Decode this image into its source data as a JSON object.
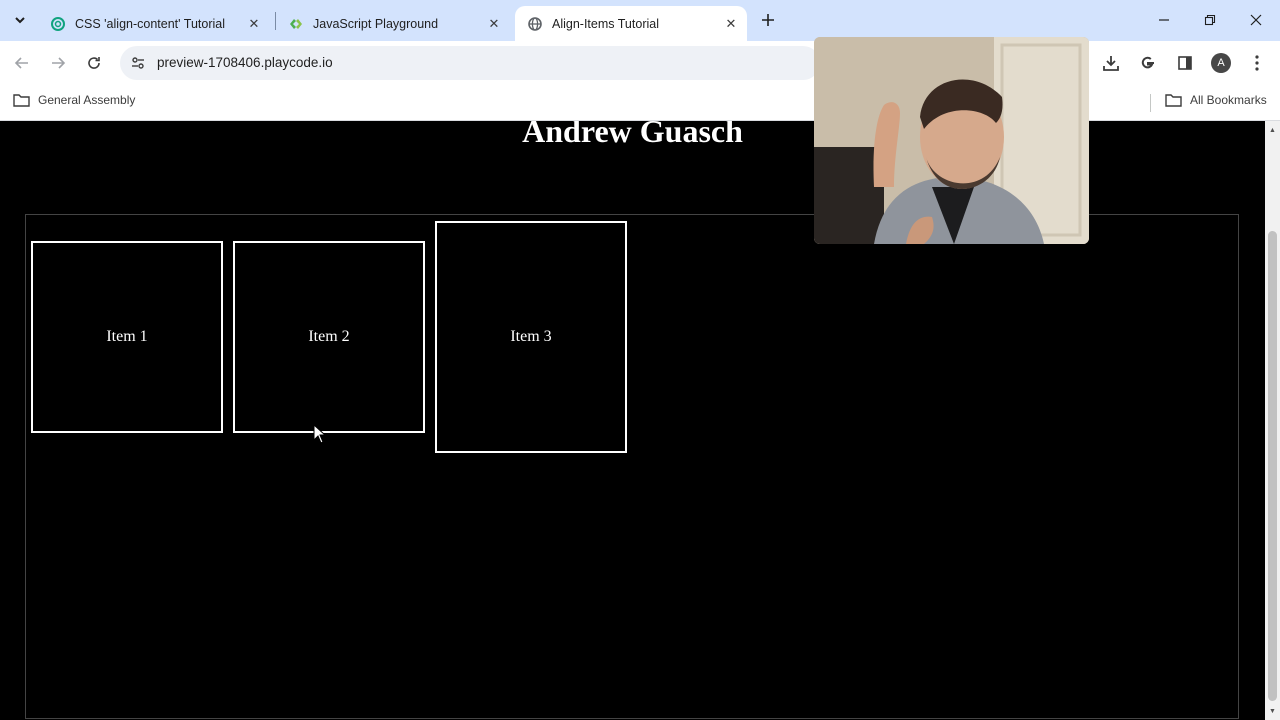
{
  "browser": {
    "tabs": [
      {
        "title": "CSS 'align-content' Tutorial",
        "favicon": "chatgpt-icon",
        "active": false
      },
      {
        "title": "JavaScript Playground",
        "favicon": "playcode-icon",
        "active": false
      },
      {
        "title": "Align-Items Tutorial",
        "favicon": "globe-icon",
        "active": true
      }
    ],
    "url": "preview-1708406.playcode.io",
    "profile_initial": "A",
    "bookmarks": {
      "left_folder": "General Assembly",
      "right_folder": "All Bookmarks"
    }
  },
  "page": {
    "heading": "Andrew Guasch",
    "items": [
      {
        "label": "Item 1"
      },
      {
        "label": "Item 2"
      },
      {
        "label": "Item 3"
      }
    ]
  },
  "colors": {
    "tabstrip": "#d3e3fd",
    "page_background": "#000000",
    "item_border": "#ffffff"
  }
}
